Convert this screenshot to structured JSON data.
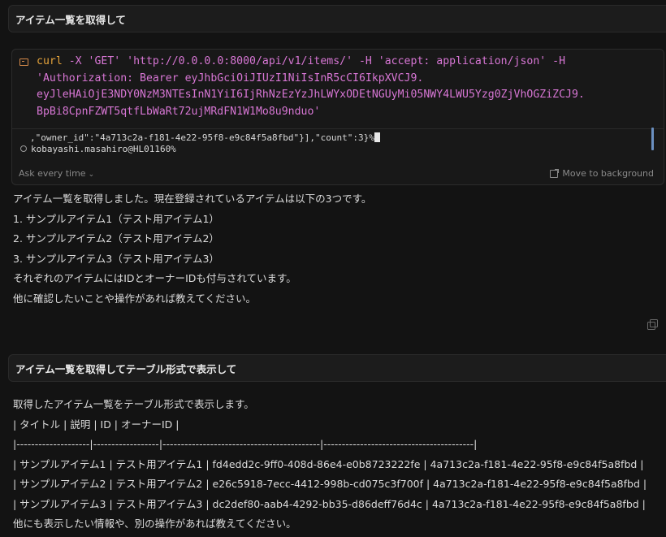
{
  "messages": {
    "first": "アイテム一覧を取得して",
    "second": "アイテム一覧を取得してテーブル形式で表示して"
  },
  "terminal": {
    "command_keyword": "curl",
    "command_rest_line1": " -X 'GET' 'http://0.0.0.0:8000/api/v1/items/' -H 'accept: application/json' -H",
    "command_line2": "'Authorization: Bearer eyJhbGciOiJIUzI1NiIsInR5cCI6IkpXVCJ9.",
    "command_line3": "eyJleHAiOjE3NDY0NzM3NTEsInN1YiI6IjRhNzEzYzJhLWYxODEtNGUyMi05NWY4LWU5Yzg0ZjVhOGZiZCJ9.",
    "command_line4": "BpBi8CpnFZWT5qtfLbWaRt72ujMRdFN1W1Mo8u9nduo'",
    "output_line1": ",\"owner_id\":\"4a713c2a-f181-4e22-95f8-e9c84f5a8fbd\"}],\"count\":3}%",
    "output_line2": "kobayashi.masahiro@HL01160%",
    "ask_label": "Ask every time",
    "move_label": "Move to background"
  },
  "response1": {
    "lines": [
      "アイテム一覧を取得しました。現在登録されているアイテムは以下の3つです。",
      "1. サンプルアイテム1（テスト用アイテム1）",
      "2. サンプルアイテム2（テスト用アイテム2）",
      "3. サンプルアイテム3（テスト用アイテム3）",
      "それぞれのアイテムにはIDとオーナーIDも付与されています。",
      "他に確認したいことや操作があれば教えてください。"
    ]
  },
  "response2": {
    "lines": [
      "取得したアイテム一覧をテーブル形式で表示します。",
      "| タイトル | 説明 | ID | オーナーID |",
      "|--------------------|------------------|-------------------------------------------|-----------------------------------------|",
      "| サンプルアイテム1 | テスト用アイテム1 | fd4edd2c-9ff0-408d-86e4-e0b8723222fe | 4a713c2a-f181-4e22-95f8-e9c84f5a8fbd |",
      "| サンプルアイテム2 | テスト用アイテム2 | e26c5918-7ecc-4412-998b-cd075c3f700f | 4a713c2a-f181-4e22-95f8-e9c84f5a8fbd |",
      "| サンプルアイテム3 | テスト用アイテム3 | dc2def80-aab4-4292-bb35-d86deff76d4c | 4a713c2a-f181-4e22-95f8-e9c84f5a8fbd |",
      "他にも表示したい情報や、別の操作があれば教えてください。"
    ]
  }
}
